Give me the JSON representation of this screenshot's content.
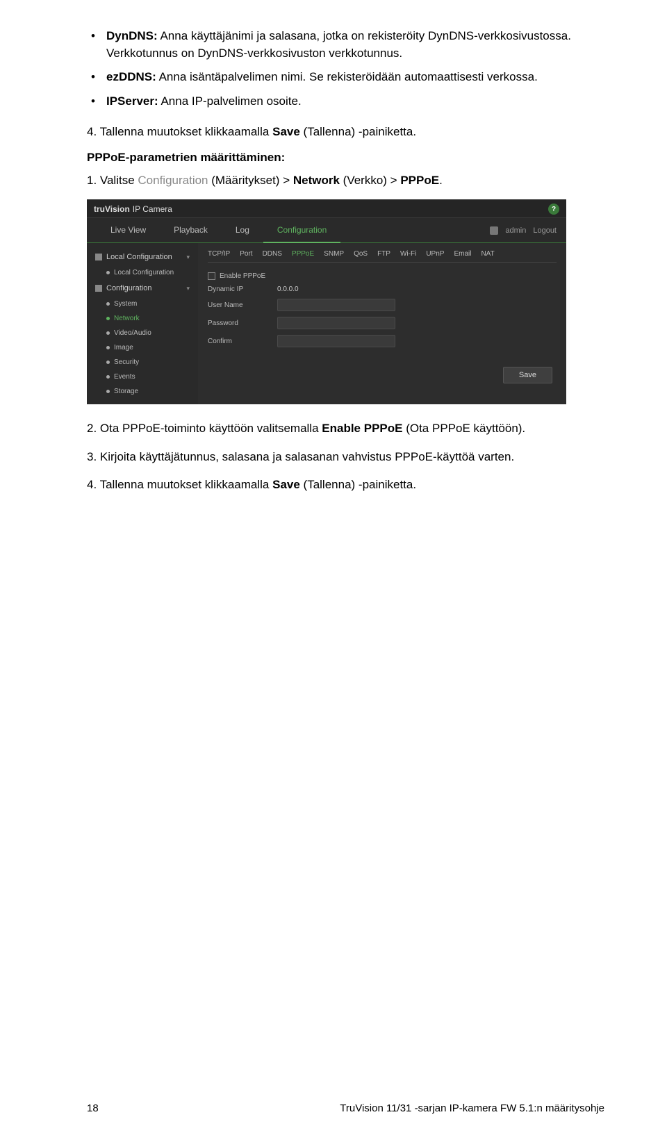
{
  "bullets": {
    "b1_label": "DynDNS:",
    "b1_text": " Anna käyttäjänimi ja salasana, jotka on rekisteröity DynDNS-verkkosivustossa. Verkkotunnus on DynDNS-verkkosivuston verkkotunnus.",
    "b2_label": "ezDDNS:",
    "b2_text": " Anna isäntäpalvelimen nimi. Se rekisteröidään automaattisesti verkossa.",
    "b3_label": "IPServer:",
    "b3_text": " Anna IP-palvelimen osoite."
  },
  "step4a_pre": "4. Tallenna muutokset klikkaamalla ",
  "step4a_bold": "Save",
  "step4a_post": " (Tallenna) -painiketta.",
  "heading": "PPPoE-parametrien määrittäminen:",
  "step1_pre": "1. Valitse ",
  "step1_mid1": "Configuration",
  "step1_plain1": " (Määritykset) > ",
  "step1_bold1": "Network",
  "step1_plain2": " (Verkko) > ",
  "step1_bold2": "PPPoE",
  "step1_dot": ".",
  "step2_pre": "2. Ota PPPoE-toiminto käyttöön valitsemalla ",
  "step2_bold": "Enable PPPoE",
  "step2_post": " (Ota PPPoE käyttöön).",
  "step3": "3. Kirjoita käyttäjätunnus, salasana ja salasanan vahvistus PPPoE-käyttöä varten.",
  "step4b_pre": "4. Tallenna muutokset klikkaamalla ",
  "step4b_bold": "Save",
  "step4b_post": " (Tallenna) -painiketta.",
  "footer": {
    "page": "18",
    "doc": "TruVision 11/31 -sarjan IP-kamera FW 5.1:n määritysohje"
  },
  "shot": {
    "brand1": "tru",
    "brand2": "Vision",
    "brand3": " IP Camera",
    "help": "?",
    "nav": {
      "live": "Live View",
      "playback": "Playback",
      "log": "Log",
      "config": "Configuration"
    },
    "user": "admin",
    "logout": "Logout",
    "side": {
      "g1": "Local Configuration",
      "s1": "Local Configuration",
      "g2": "Configuration",
      "s2": "System",
      "s3": "Network",
      "s4": "Video/Audio",
      "s5": "Image",
      "s6": "Security",
      "s7": "Events",
      "s8": "Storage"
    },
    "tabs": {
      "t1": "TCP/IP",
      "t2": "Port",
      "t3": "DDNS",
      "t4": "PPPoE",
      "t5": "SNMP",
      "t6": "QoS",
      "t7": "FTP",
      "t8": "Wi-Fi",
      "t9": "UPnP",
      "t10": "Email",
      "t11": "NAT"
    },
    "form": {
      "enable": "Enable PPPoE",
      "dyn": "Dynamic IP",
      "dynval": "0.0.0.0",
      "user": "User Name",
      "pass": "Password",
      "conf": "Confirm"
    },
    "save": "Save"
  }
}
